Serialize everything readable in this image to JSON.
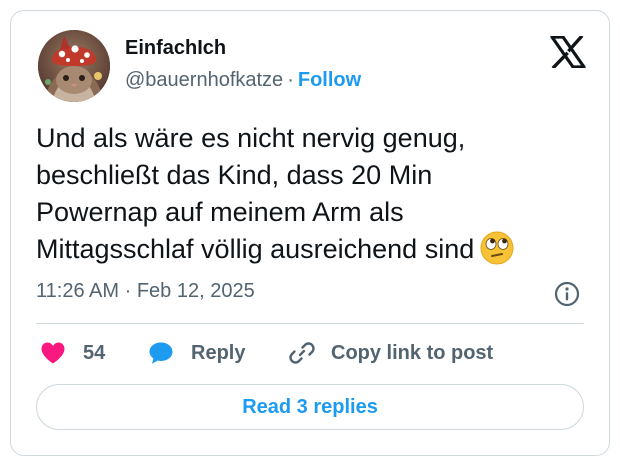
{
  "author": {
    "display_name": "EinfachIch",
    "handle": "@bauernhofkatze",
    "separator": "·",
    "follow_label": "Follow",
    "avatar_icon": "cat-avatar-with-mushroom-hat"
  },
  "brand": {
    "logo_icon": "x-logo"
  },
  "tweet": {
    "lines": [
      "Und als wäre es nicht nervig genug,",
      "beschließt das Kind, dass 20 Min",
      "Powernap auf meinem Arm als",
      "Mittagsschlaf völlig ausreichend sind"
    ],
    "emoji_icon": "face-with-rolling-eyes-emoji"
  },
  "meta": {
    "time": "11:26 AM",
    "separator": "·",
    "date": "Feb 12, 2025",
    "info_icon": "info-icon"
  },
  "actions": {
    "like": {
      "icon": "heart-icon",
      "count": "54",
      "color": "#f91880"
    },
    "reply": {
      "icon": "speech-bubble-icon",
      "label": "Reply",
      "color": "#1d9bf0"
    },
    "copy": {
      "icon": "link-icon",
      "label": "Copy link to post"
    }
  },
  "replies": {
    "label": "Read 3 replies"
  },
  "colors": {
    "accent": "#1d9bf0",
    "text_primary": "#0f1419",
    "text_secondary": "#536471",
    "border": "#cfd9de"
  }
}
